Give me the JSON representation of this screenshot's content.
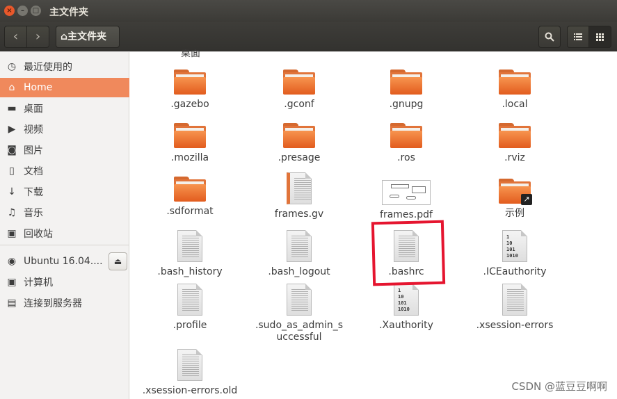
{
  "window": {
    "title": "主文件夹"
  },
  "toolbar": {
    "back": "‹",
    "forward": "›",
    "path_label": "主文件夹"
  },
  "sidebar": {
    "items": [
      {
        "label": "最近使用的",
        "icon": "clock-icon"
      },
      {
        "label": "Home",
        "icon": "home-icon"
      },
      {
        "label": "桌面",
        "icon": "folder-icon"
      },
      {
        "label": "视频",
        "icon": "video-icon"
      },
      {
        "label": "图片",
        "icon": "camera-icon"
      },
      {
        "label": "文档",
        "icon": "document-icon"
      },
      {
        "label": "下载",
        "icon": "download-icon"
      },
      {
        "label": "音乐",
        "icon": "music-icon"
      },
      {
        "label": "回收站",
        "icon": "trash-icon"
      }
    ],
    "devices": [
      {
        "label": "Ubuntu 16.04....",
        "icon": "disc-icon"
      },
      {
        "label": "计算机",
        "icon": "computer-icon"
      },
      {
        "label": "连接到服务器",
        "icon": "server-icon"
      }
    ]
  },
  "files": [
    {
      "name": ".gazebo",
      "type": "folder"
    },
    {
      "name": ".gconf",
      "type": "folder"
    },
    {
      "name": ".gnupg",
      "type": "folder"
    },
    {
      "name": ".local",
      "type": "folder"
    },
    {
      "name": ".mozilla",
      "type": "folder"
    },
    {
      "name": ".presage",
      "type": "folder"
    },
    {
      "name": ".ros",
      "type": "folder"
    },
    {
      "name": ".rviz",
      "type": "folder"
    },
    {
      "name": ".sdformat",
      "type": "folder"
    },
    {
      "name": "frames.gv",
      "type": "text"
    },
    {
      "name": "frames.pdf",
      "type": "pdf"
    },
    {
      "name": "示例",
      "type": "folder-link"
    },
    {
      "name": ".bash_history",
      "type": "text"
    },
    {
      "name": ".bash_logout",
      "type": "text"
    },
    {
      "name": ".bashrc",
      "type": "text"
    },
    {
      "name": ".ICEauthority",
      "type": "binary"
    },
    {
      "name": ".profile",
      "type": "text"
    },
    {
      "name": ".sudo_as_admin_successful",
      "type": "text"
    },
    {
      "name": ".Xauthority",
      "type": "binary"
    },
    {
      "name": ".xsession-errors",
      "type": "text"
    },
    {
      "name": ".xsession-errors.old",
      "type": "text"
    }
  ],
  "cutoff_label": "桌面",
  "binary_glyph": [
    "1",
    "10",
    "101",
    "1010"
  ],
  "highlight_color": "#e5152f",
  "accent_color": "#f0895c",
  "watermark": "CSDN @蓝豆豆啊啊"
}
